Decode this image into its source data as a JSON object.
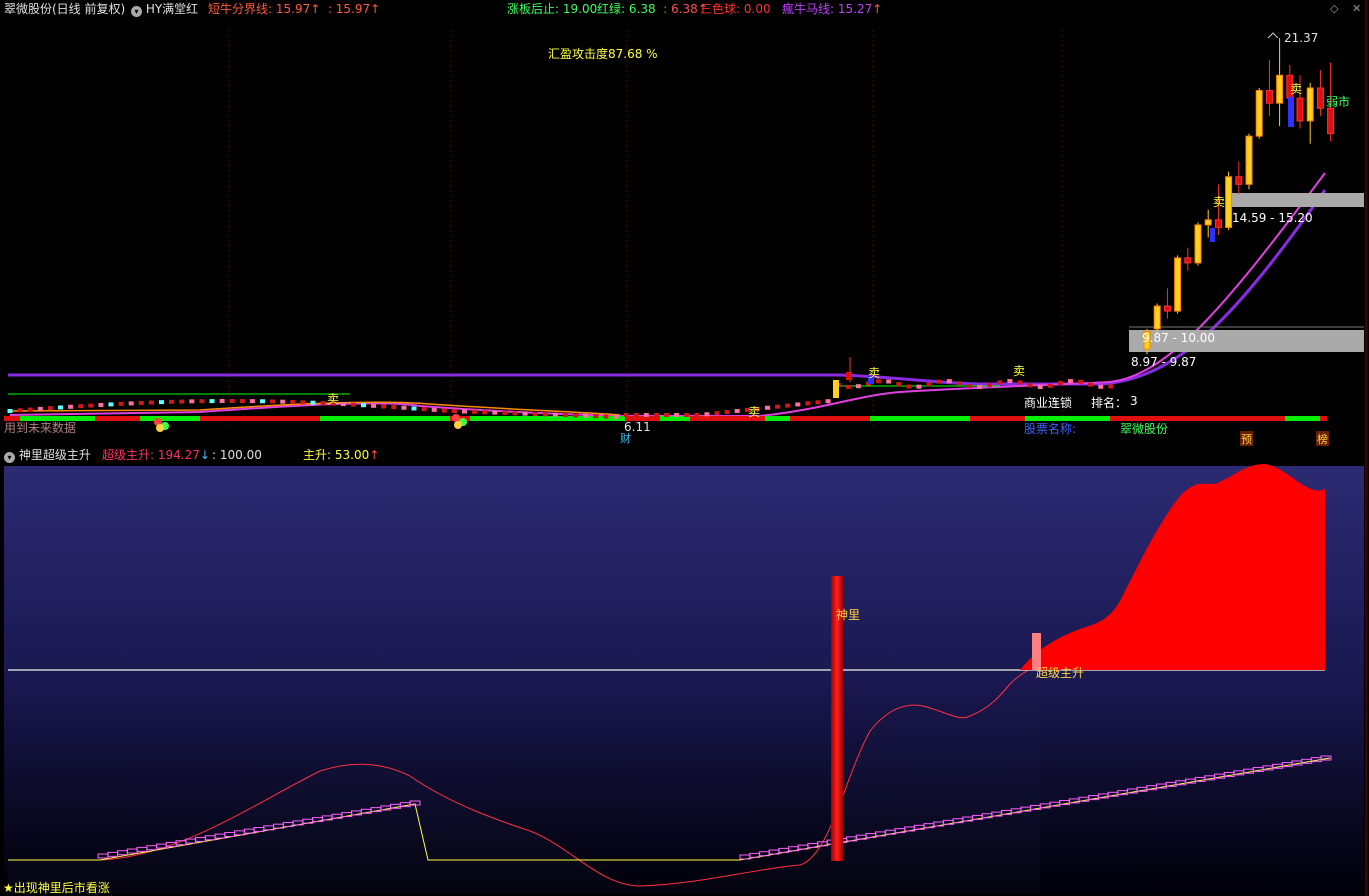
{
  "main": {
    "title": "翠微股份(日线 前复权)",
    "indicator_name": "HY满堂红",
    "short_bull": {
      "label": "短牛分界线:",
      "value": "15.97",
      "value2": ": 15.97",
      "color": "#ff5a3c"
    },
    "limit_stop": {
      "label": "涨板后止:",
      "value": "19.00",
      "color": "#3cff5a"
    },
    "red_green": {
      "label": "红绿:",
      "value": "6.38",
      "value2": ": 6.38",
      "color": "#3cff5a"
    },
    "three_color": {
      "label": "三色球:",
      "value": "0.00",
      "color": "#ff3030"
    },
    "crazy_bull": {
      "label": "瘋牛马线:",
      "value": "15.27",
      "color": "#c040ff"
    },
    "attack_degree": "汇盈攻击度87.68 %",
    "price_high": "21.37",
    "price_low": "6.11",
    "zone_upper": "14.59 - 15.20",
    "zone_lower_a": "9.87 - 10.00",
    "zone_lower_b": "8.97 - 9.87",
    "sell_mark": "卖",
    "market_label": "弱市",
    "future_data": "用到未来数据",
    "fin_mark": "财",
    "info_topic_label": "商业连锁",
    "info_rank_label": "排名：",
    "info_rank_value": "3",
    "info_name_label": "股票名称:",
    "info_name_value": "翠微股份",
    "tag_pre": "预",
    "tag_rank": "榜",
    "arrow_up": "↑"
  },
  "sub": {
    "title": "神里超级主升",
    "super_main": {
      "label": "超级主升:",
      "value": "194.27",
      "arrow": "↓",
      "color": "#ff3060"
    },
    "level": ": 100.00",
    "main_up": {
      "label": "主升:",
      "value": "53.00",
      "arrow": "↑",
      "color": "#ffff40"
    },
    "shenli_label": "神里",
    "super_label": "超级主升",
    "footer": "★出现神里后市看涨"
  },
  "chart_data": [
    {
      "type": "candlestick",
      "title": "翠微股份(日线 前复权)",
      "price_range": [
        6.11,
        21.37
      ],
      "annotated_levels": {
        "high": 21.37,
        "low": 6.11,
        "short_bull_line": 15.97,
        "crazy_bull_line": 15.27
      },
      "candles_recent": [
        {
          "o": 9.1,
          "h": 9.9,
          "l": 8.9,
          "c": 9.8
        },
        {
          "o": 9.9,
          "h": 10.9,
          "l": 9.7,
          "c": 10.8
        },
        {
          "o": 10.8,
          "h": 11.5,
          "l": 10.3,
          "c": 10.6
        },
        {
          "o": 10.6,
          "h": 12.8,
          "l": 10.5,
          "c": 12.7
        },
        {
          "o": 12.7,
          "h": 13.1,
          "l": 12.2,
          "c": 12.5
        },
        {
          "o": 12.5,
          "h": 14.1,
          "l": 12.4,
          "c": 14.0
        },
        {
          "o": 14.0,
          "h": 14.6,
          "l": 13.5,
          "c": 14.2
        },
        {
          "o": 14.2,
          "h": 15.6,
          "l": 13.6,
          "c": 13.9
        },
        {
          "o": 13.9,
          "h": 16.1,
          "l": 13.8,
          "c": 15.9
        },
        {
          "o": 15.9,
          "h": 16.5,
          "l": 15.2,
          "c": 15.6
        },
        {
          "o": 15.6,
          "h": 17.6,
          "l": 15.4,
          "c": 17.5
        },
        {
          "o": 17.5,
          "h": 19.4,
          "l": 17.4,
          "c": 19.3
        },
        {
          "o": 19.3,
          "h": 20.5,
          "l": 18.3,
          "c": 18.8
        },
        {
          "o": 18.8,
          "h": 21.37,
          "l": 17.9,
          "c": 19.9
        },
        {
          "o": 19.9,
          "h": 20.3,
          "l": 18.6,
          "c": 19.0
        },
        {
          "o": 19.0,
          "h": 19.9,
          "l": 17.8,
          "c": 18.1
        },
        {
          "o": 18.1,
          "h": 19.6,
          "l": 17.2,
          "c": 19.4
        },
        {
          "o": 19.4,
          "h": 20.1,
          "l": 18.3,
          "c": 18.6
        },
        {
          "o": 18.6,
          "h": 20.4,
          "l": 17.3,
          "c": 17.6
        }
      ]
    },
    {
      "type": "area",
      "title": "神里超级主升",
      "reference_level": 100,
      "last_values": {
        "super_main": 194.27,
        "main_up": 53.0
      }
    }
  ]
}
